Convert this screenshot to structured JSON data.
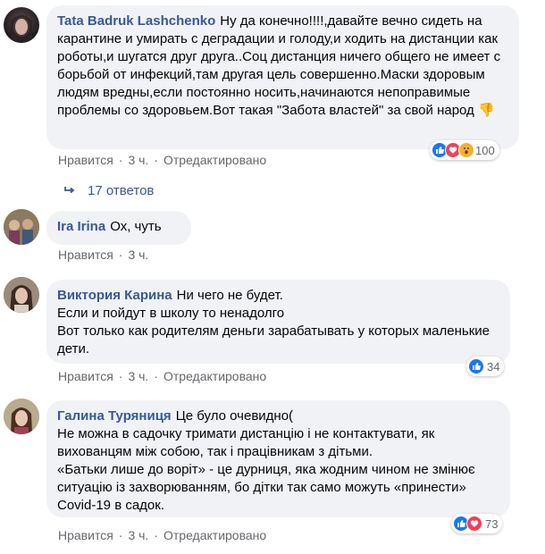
{
  "comments": [
    {
      "author": "Tata Badruk Lashchenko",
      "text": "Ну да конечно!!!!,давайте вечно сидеть на карантине и умирать с деградации и голоду,и ходить на дистанции как роботы,и шугатся друг друга..Соц дистанция ничего общего не имеет с борьбой от инфекций,там другая цель совершенно.Маски здоровым людям вредны,если постоянно носить,начинаются непоправимые проблемы со здоровьем.Вот такая \"Забота властей\" за свой народ 👎",
      "like": "Нравится",
      "time": "3 ч.",
      "edited": "Отредактировано",
      "reactions_count": "100",
      "reactions": [
        "like",
        "love",
        "wow"
      ]
    },
    {
      "author": "Ira Irina",
      "text": "Ох, чуть",
      "like": "Нравится",
      "time": "3 ч."
    },
    {
      "author": "Виктория Карина",
      "text": "Ни чего не будет.\nЕсли и пойдут в школу то ненадолго\nВот только как родителям деньги зарабатывать у которых маленькие дети.",
      "like": "Нравится",
      "time": "3 ч.",
      "edited": "Отредактировано",
      "reactions_count": "34",
      "reactions": [
        "like"
      ]
    },
    {
      "author": "Галина Туряниця",
      "text": "Це було очевидно(\nНе можна в садочку тримати дистанцію і не контактувати, як вихованцям між собою, так і працівникам з дітьми.\n«Батьки лише до воріт» - це дурниця, яка жодним чином не змінює ситуацію із захворюванням, бо дітки так само можуть «принести» Covid-19 в садок.",
      "like": "Нравится",
      "time": "3 ч.",
      "edited": "Отредактировано",
      "reactions_count": "73",
      "reactions": [
        "like",
        "love"
      ]
    }
  ],
  "replies": {
    "label": "17 ответов"
  },
  "colors": {
    "author": "#385898",
    "bubble": "#f0f2f5",
    "like": "#1877f2",
    "love": "#f33e58",
    "wow": "#f7b125"
  }
}
